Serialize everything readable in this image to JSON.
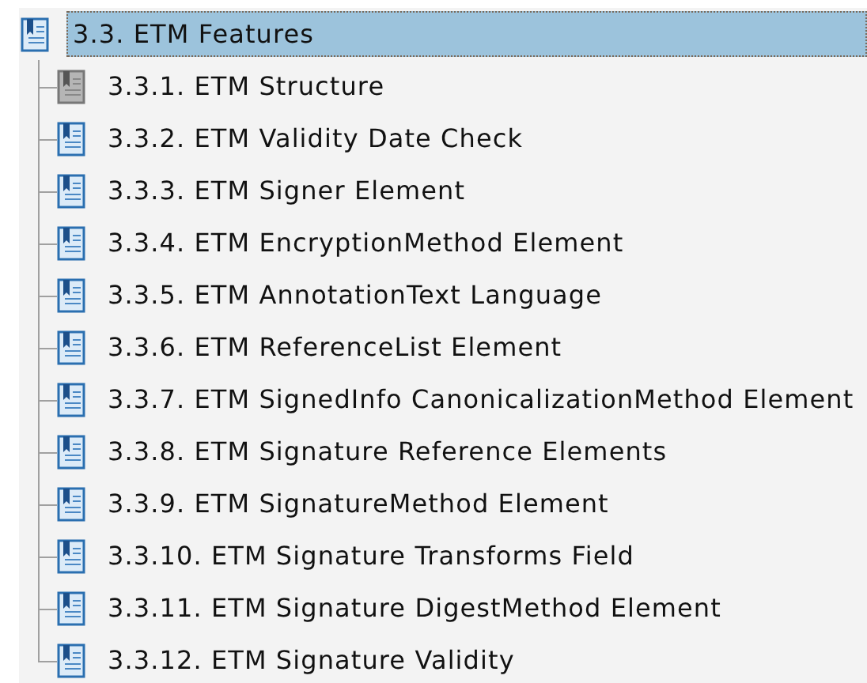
{
  "tree": {
    "label": "3.3. ETM Features",
    "selected": true,
    "disabled": false,
    "children": [
      {
        "label": "3.3.1. ETM Structure",
        "selected": false,
        "disabled": true
      },
      {
        "label": "3.3.2. ETM Validity Date Check",
        "selected": false,
        "disabled": false
      },
      {
        "label": "3.3.3. ETM Signer Element",
        "selected": false,
        "disabled": false
      },
      {
        "label": "3.3.4. ETM EncryptionMethod Element",
        "selected": false,
        "disabled": false
      },
      {
        "label": "3.3.5. ETM AnnotationText Language",
        "selected": false,
        "disabled": false
      },
      {
        "label": "3.3.6. ETM ReferenceList Element",
        "selected": false,
        "disabled": false
      },
      {
        "label": "3.3.7. ETM SignedInfo CanonicalizationMethod Element",
        "selected": false,
        "disabled": false
      },
      {
        "label": "3.3.8. ETM Signature Reference Elements",
        "selected": false,
        "disabled": false
      },
      {
        "label": "3.3.9. ETM SignatureMethod Element",
        "selected": false,
        "disabled": false
      },
      {
        "label": "3.3.10. ETM Signature Transforms Field",
        "selected": false,
        "disabled": false
      },
      {
        "label": "3.3.11. ETM Signature DigestMethod Element",
        "selected": false,
        "disabled": false
      },
      {
        "label": "3.3.12. ETM Signature Validity",
        "selected": false,
        "disabled": false
      }
    ]
  }
}
